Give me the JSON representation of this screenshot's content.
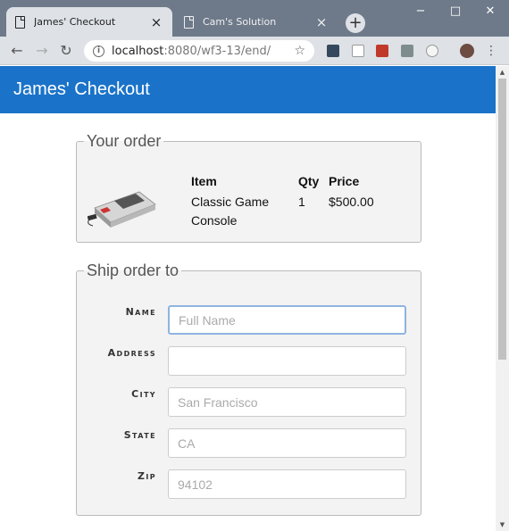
{
  "browser": {
    "tabs": [
      {
        "title": "James' Checkout",
        "active": true
      },
      {
        "title": "Cam's Solution",
        "active": false
      }
    ],
    "url_host": "localhost",
    "url_path": ":8080/wf3-13/end/"
  },
  "page": {
    "title": "James' Checkout",
    "order": {
      "legend": "Your order",
      "columns": [
        "Item",
        "Qty",
        "Price"
      ],
      "rows": [
        {
          "item": "Classic Game Console",
          "qty": "1",
          "price": "$500.00"
        }
      ]
    },
    "ship": {
      "legend": "Ship order to",
      "fields": [
        {
          "label": "Name",
          "value": "",
          "placeholder": "Full Name"
        },
        {
          "label": "Address",
          "value": "",
          "placeholder": ""
        },
        {
          "label": "City",
          "value": "",
          "placeholder": "San Francisco"
        },
        {
          "label": "State",
          "value": "",
          "placeholder": "CA"
        },
        {
          "label": "Zip",
          "value": "",
          "placeholder": "94102"
        }
      ]
    }
  },
  "colors": {
    "header": "#1a73c9",
    "focus_border": "#8fb4e0"
  },
  "icons": [
    "doc-icon",
    "close-icon",
    "plus-icon",
    "back-icon",
    "forward-icon",
    "reload-icon",
    "info-icon",
    "star-icon",
    "menu-icon"
  ]
}
